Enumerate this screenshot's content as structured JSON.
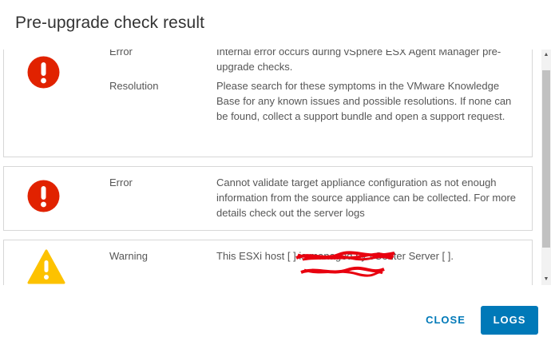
{
  "dialog": {
    "title": "Pre-upgrade check result"
  },
  "results": [
    {
      "severity": "error",
      "icon": "error-circle-icon",
      "rows": [
        {
          "label": "Error",
          "text": "Internal error occurs during vSphere ESX Agent Manager pre-upgrade checks."
        },
        {
          "label": "Resolution",
          "text": "Please search for these symptoms in the VMware Knowledge Base for any known issues and possible resolutions. If none can be found, collect a support bundle and open a support request."
        }
      ]
    },
    {
      "severity": "error",
      "icon": "error-circle-icon",
      "rows": [
        {
          "label": "Error",
          "text": "Cannot validate target appliance configuration as not enough information from the source appliance can be collected. For more details check out the server logs"
        }
      ]
    },
    {
      "severity": "warning",
      "icon": "warning-triangle-icon",
      "rows": [
        {
          "label": "Warning",
          "text": "This ESXi host [ ] is managed by vCenter Server [ ]."
        }
      ]
    }
  ],
  "buttons": {
    "close": "CLOSE",
    "logs": "LOGS"
  },
  "colors": {
    "error": "#e12200",
    "warning": "#fdc200",
    "primary": "#0079b8",
    "redaction": "#e8000f"
  }
}
